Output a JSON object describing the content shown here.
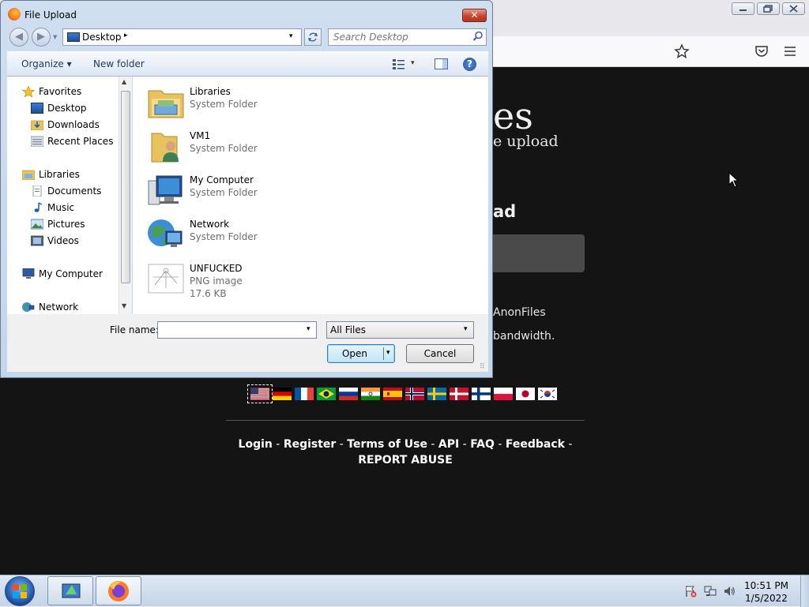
{
  "dialog": {
    "title": "File Upload",
    "close_label": "✕",
    "address": {
      "location": "Desktop",
      "arrow": "▸",
      "dropdown": "▾"
    },
    "search": {
      "placeholder": "Search Desktop"
    },
    "commands": {
      "organize": "Organize ▾",
      "new_folder": "New folder",
      "views_dropdown": "▾",
      "help": "?"
    },
    "nav": {
      "favorites": {
        "label": "Favorites",
        "items": [
          "Desktop",
          "Downloads",
          "Recent Places"
        ]
      },
      "libraries": {
        "label": "Libraries",
        "items": [
          "Documents",
          "Music",
          "Pictures",
          "Videos"
        ]
      },
      "computer": "My Computer",
      "network": "Network"
    },
    "files": [
      {
        "name": "Libraries",
        "type": "System Folder",
        "icon": "libraries-icon"
      },
      {
        "name": "VM1",
        "type": "System Folder",
        "icon": "user-folder-icon"
      },
      {
        "name": "My Computer",
        "type": "System Folder",
        "icon": "computer-icon"
      },
      {
        "name": "Network",
        "type": "System Folder",
        "icon": "network-icon"
      },
      {
        "name": "UNFUCKED",
        "type": "PNG image",
        "size": "17.6 KB",
        "icon": "png-thumbnail"
      }
    ],
    "filename": {
      "label": "File name:",
      "value": "",
      "dropdown": "▾"
    },
    "filetype": {
      "value": "All Files",
      "dropdown": "▾"
    },
    "buttons": {
      "open": "Open",
      "open_drop": "▾",
      "cancel": "Cancel"
    }
  },
  "page": {
    "title_fragment": "es",
    "subtitle_fragment": "e upload",
    "upload_heading_fragment": "ad",
    "line1_fragment": "AnonFiles",
    "line2_fragment": "bandwidth.",
    "flags": [
      "us",
      "de",
      "fr",
      "br",
      "ru",
      "in",
      "es",
      "no",
      "se",
      "dk",
      "fi",
      "pl",
      "jp",
      "kr"
    ],
    "footer": {
      "login": "Login",
      "register": "Register",
      "terms": "Terms of Use",
      "api": "API",
      "faq": "FAQ",
      "feedback": "Feedback",
      "report": "REPORT ABUSE",
      "sep": " - "
    }
  },
  "taskbar": {
    "time": "10:51 PM",
    "date": "1/5/2022"
  },
  "colors": {
    "page_bg": "#141414",
    "dialog_frame": "#c2d6ec",
    "taskbar": "#c4d3e6",
    "close_red": "#c9432f"
  }
}
